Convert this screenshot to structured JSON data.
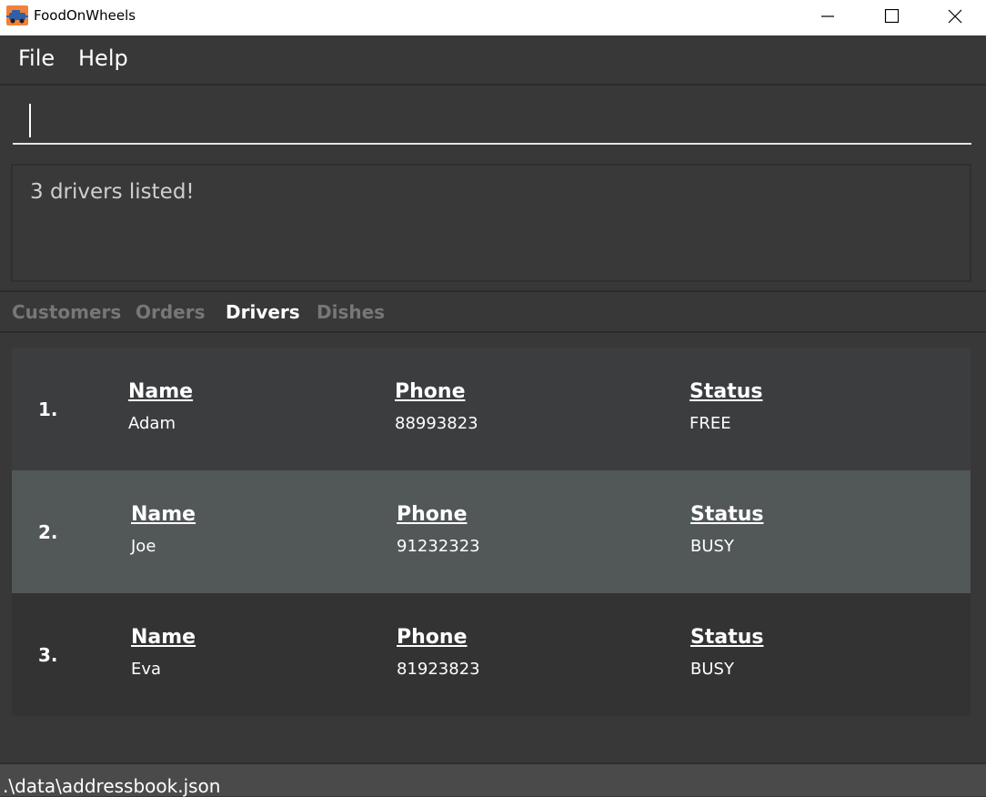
{
  "window": {
    "title": "FoodOnWheels",
    "icon": "app-logo-icon",
    "controls": [
      "minimize-icon",
      "maximize-icon",
      "close-icon"
    ]
  },
  "menu": {
    "file": "File",
    "help": "Help"
  },
  "command": {
    "value": "",
    "placeholder": ""
  },
  "result": {
    "message": "3 drivers listed!"
  },
  "tabs": {
    "customers": "Customers",
    "orders": "Orders",
    "drivers": "Drivers",
    "dishes": "Dishes",
    "active": "Drivers"
  },
  "drivers": [
    {
      "index": "1.",
      "name_label": "Name",
      "name": "Adam",
      "phone_label": "Phone",
      "phone": "88993823",
      "status_label": "Status",
      "status": "FREE"
    },
    {
      "index": "2.",
      "name_label": "Name",
      "name": "Joe",
      "phone_label": "Phone",
      "phone": "91232323",
      "status_label": "Status",
      "status": "BUSY"
    },
    {
      "index": "3.",
      "name_label": "Name",
      "name": "Eva",
      "phone_label": "Phone",
      "phone": "81923823",
      "status_label": "Status",
      "status": "BUSY"
    }
  ],
  "status_bar": {
    "path": ".\\data\\addressbook.json"
  },
  "colors": {
    "background": "#383838",
    "title_bar": "#ffffff",
    "card": "#3b3d3f",
    "card_alt": "#333333",
    "card_selected": "#525758",
    "status_bar": "#4a4a4a",
    "icon_accent": "#f0813c"
  }
}
